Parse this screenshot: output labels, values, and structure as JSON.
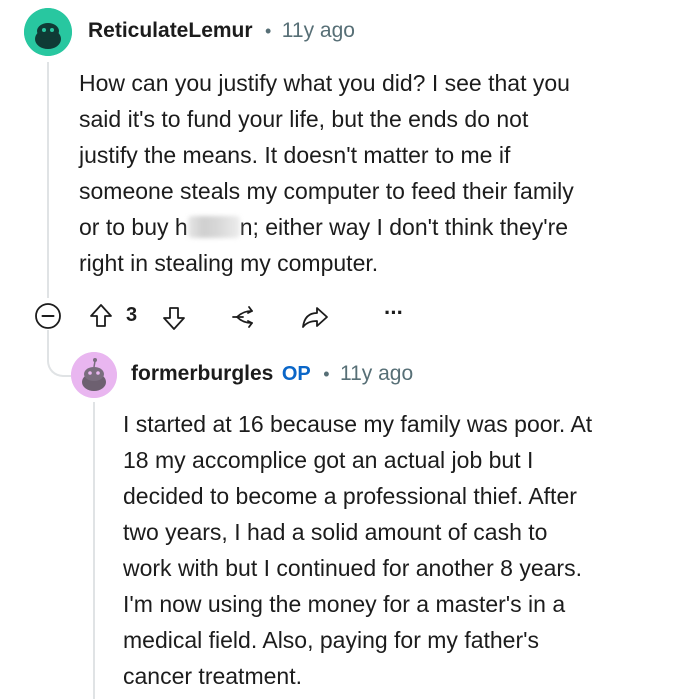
{
  "colors": {
    "accent_op": "#0a66c8",
    "meta": "#576f76",
    "text": "#1c1c1c"
  },
  "comment": {
    "username": "ReticulateLemur",
    "separator": "•",
    "age": "11y ago",
    "lines": [
      "How can you justify what you did? I see that you",
      "said it's to fund your life, but the ends do not",
      "justify the means. It doesn't matter to me if",
      "someone steals my computer to feed their family"
    ],
    "line5_pre": "or to buy h",
    "line5_post": "n; either way I don't think they're",
    "line6": "right in stealing my computer.",
    "actions": {
      "collapse_icon": "collapse-minus-icon",
      "upvote_icon": "upvote-arrow-icon",
      "vote_count": "3",
      "downvote_icon": "downvote-arrow-icon",
      "award_icon": "award-icon",
      "share_icon": "share-icon",
      "more_icon": "more-ellipsis-icon",
      "more_label": "···"
    }
  },
  "reply": {
    "username": "formerburgles",
    "op_badge": "OP",
    "separator": "•",
    "age": "11y ago",
    "lines": [
      "I started at 16 because my family was poor. At",
      "18 my accomplice got an actual job but I",
      "decided to become a professional thief. After",
      "two years, I had a solid amount of cash to",
      "work with but I continued for another 8 years.",
      "I'm now using the money for a master's in a",
      "medical field. Also, paying for my father's",
      "cancer treatment."
    ]
  }
}
